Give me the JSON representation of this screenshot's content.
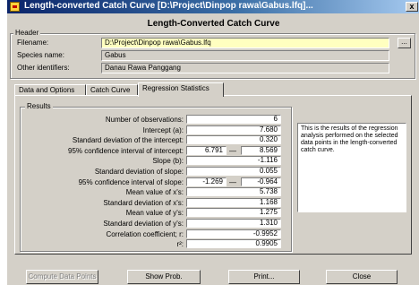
{
  "window": {
    "title": "Length-converted Catch Curve [D:\\Project\\Dinpop rawa\\Gabus.lfq]...",
    "close_label": "x"
  },
  "dialog_heading": "Length-Converted Catch Curve",
  "header": {
    "group_label": "Header",
    "filename_label": "Filename:",
    "filename_value": "D:\\Project\\Dinpop rawa\\Gabus.lfq",
    "browse_label": "...",
    "species_label": "Species name:",
    "species_value": "Gabus",
    "other_label": "Other identifiers:",
    "other_value": "Danau Rawa Panggang"
  },
  "tabs": [
    {
      "label": "Data and Options"
    },
    {
      "label": "Catch Curve"
    },
    {
      "label": "Regression Statistics"
    }
  ],
  "results": {
    "group_label": "Results",
    "rows": [
      {
        "label": "Number of observations:",
        "value": "6"
      },
      {
        "label": "Intercept (a):",
        "value": "7.680"
      },
      {
        "label": "Standard deviation of the intercept:",
        "value": "0.320"
      },
      {
        "label": "95% confidence interval of intercept:",
        "low": "6.791",
        "high": "8.569"
      },
      {
        "label": "Slope (b):",
        "value": "-1.116"
      },
      {
        "label": "Standard deviation of slope:",
        "value": "0.055"
      },
      {
        "label": "95% confidence interval of slope:",
        "low": "-1.269",
        "high": "-0.964"
      },
      {
        "label": "Mean value of x's:",
        "value": "5.738"
      },
      {
        "label": "Standard deviation of x's:",
        "value": "1.168"
      },
      {
        "label": "Mean value of y's:",
        "value": "1.275"
      },
      {
        "label": "Standard deviation of y's:",
        "value": "1.310"
      },
      {
        "label": "Correlation coefficient; r:",
        "value": "-0.9952"
      },
      {
        "label": "r²:",
        "value": "0.9905"
      }
    ],
    "ci_separator": "—"
  },
  "info_text": "This is the results of the regression analysis performed on the selected data points in the length-converted catch curve.",
  "buttons": {
    "compute": "Compute Data Points",
    "show_prob": "Show Prob.",
    "print": "Print...",
    "close": "Close"
  },
  "colors": {
    "dialog_bg": "#d4d0c8",
    "titlebar_start": "#0a246a",
    "filename_bg": "#ffffc0"
  }
}
